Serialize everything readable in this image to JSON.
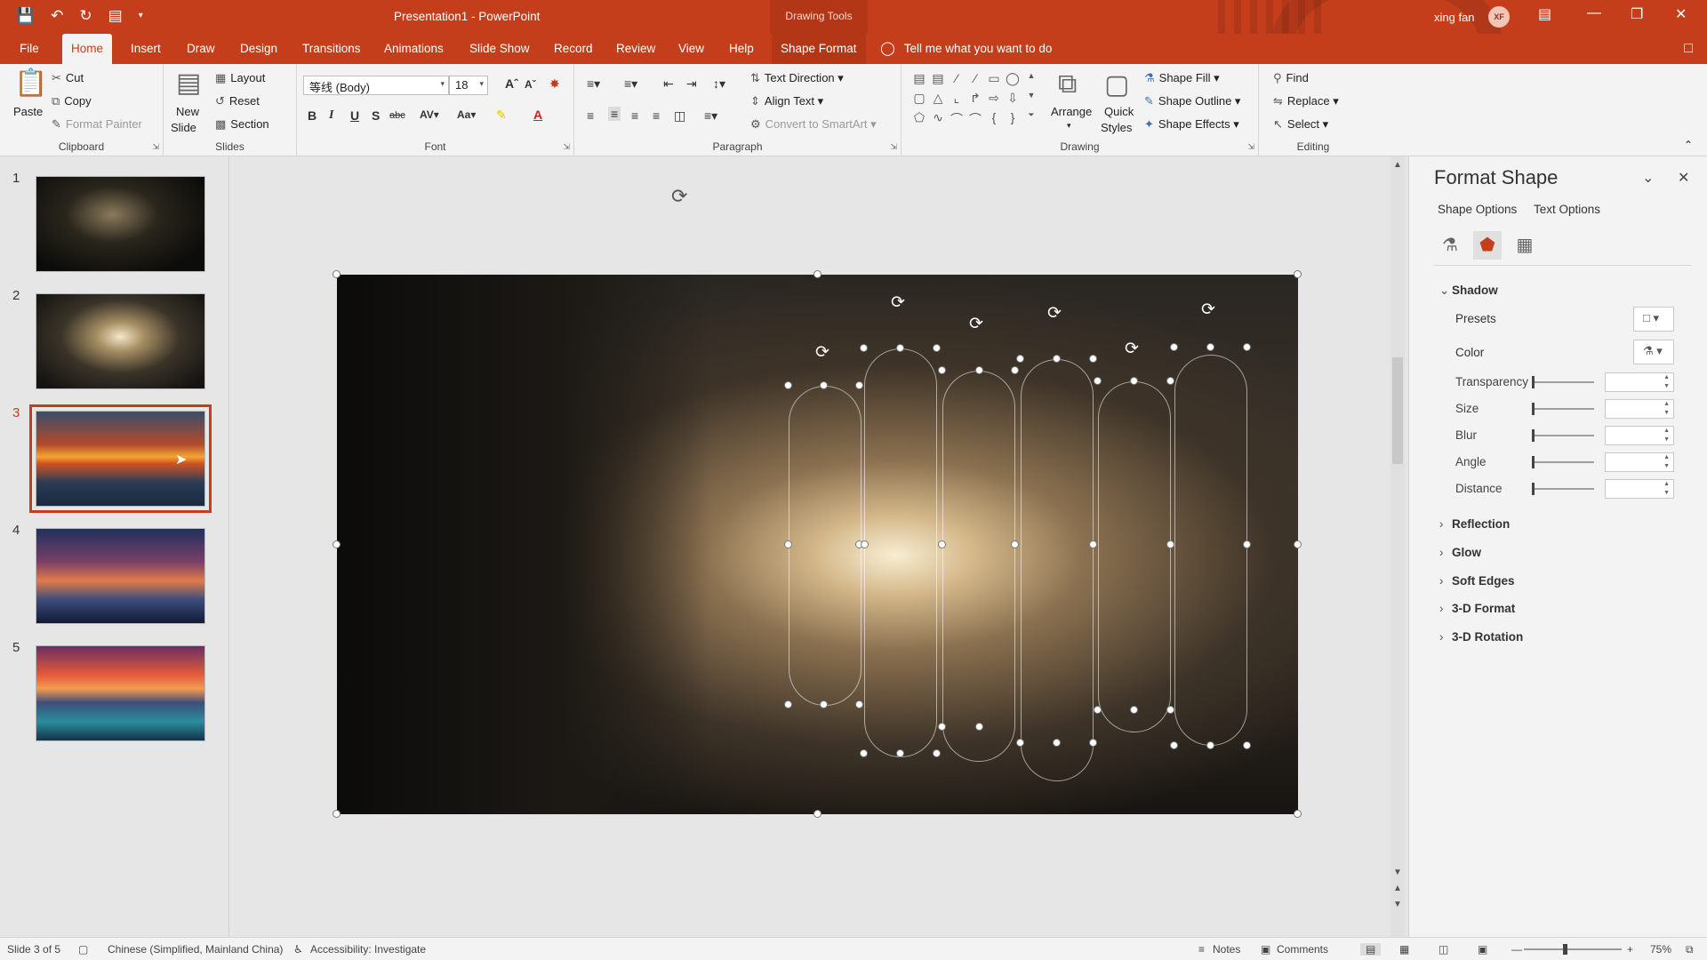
{
  "titlebar": {
    "document_title": "Presentation1 - PowerPoint",
    "contextual_group": "Drawing Tools",
    "user_name": "xing fan",
    "user_initials": "XF"
  },
  "tabs": [
    "File",
    "Home",
    "Insert",
    "Draw",
    "Design",
    "Transitions",
    "Animations",
    "Slide Show",
    "Record",
    "Review",
    "View",
    "Help",
    "Shape Format"
  ],
  "tell_me": "Tell me what you want to do",
  "ribbon": {
    "clipboard": {
      "label": "Clipboard",
      "paste": "Paste",
      "cut": "Cut",
      "copy": "Copy",
      "format_painter": "Format Painter"
    },
    "slides": {
      "label": "Slides",
      "new_slide_1": "New",
      "new_slide_2": "Slide",
      "layout": "Layout",
      "reset": "Reset",
      "section": "Section"
    },
    "font": {
      "label": "Font",
      "font_name": "等线 (Body)",
      "font_size": "18"
    },
    "paragraph": {
      "label": "Paragraph",
      "text_direction": "Text Direction",
      "align_text": "Align Text",
      "convert_smartart": "Convert to SmartArt"
    },
    "drawing": {
      "label": "Drawing",
      "arrange": "Arrange",
      "quick_styles_1": "Quick",
      "quick_styles_2": "Styles",
      "shape_fill": "Shape Fill",
      "shape_outline": "Shape Outline",
      "shape_effects": "Shape Effects"
    },
    "editing": {
      "label": "Editing",
      "find": "Find",
      "replace": "Replace",
      "select": "Select"
    }
  },
  "slides": {
    "numbers": [
      "1",
      "2",
      "3",
      "4",
      "5"
    ],
    "selected": 3
  },
  "format_pane": {
    "title": "Format Shape",
    "tab_shape_options": "Shape Options",
    "tab_text_options": "Text Options",
    "shadow": {
      "header": "Shadow",
      "presets": "Presets",
      "color": "Color",
      "transparency": "Transparency",
      "size": "Size",
      "blur": "Blur",
      "angle": "Angle",
      "distance": "Distance"
    },
    "sections": [
      "Reflection",
      "Glow",
      "Soft Edges",
      "3-D Format",
      "3-D Rotation"
    ]
  },
  "statusbar": {
    "slide_info": "Slide 3 of 5",
    "language": "Chinese (Simplified, Mainland China)",
    "accessibility": "Accessibility: Investigate",
    "notes": "Notes",
    "comments": "Comments",
    "zoom": "75%"
  },
  "colors": {
    "accent": "#c43e1c",
    "ribbon_bg": "#f3f3f3",
    "canvas_bg": "#e6e6e6"
  }
}
